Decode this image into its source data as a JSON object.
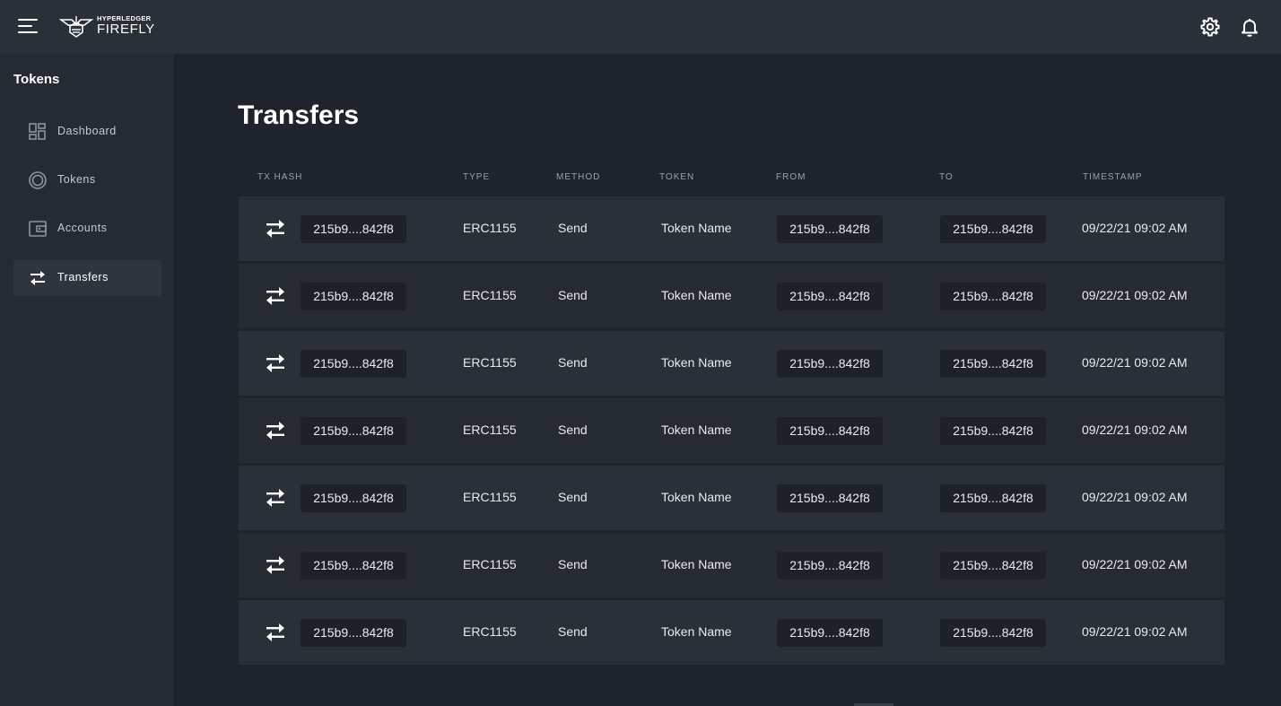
{
  "header": {
    "logo_small": "HYPERLEDGER",
    "logo_big": "FIREFLY",
    "menu_icon": "hamburger-menu-icon",
    "settings_icon": "gear-icon",
    "notifications_icon": "bell-icon"
  },
  "sidebar": {
    "title": "Tokens",
    "items": [
      {
        "label": "Dashboard",
        "icon": "dashboard-icon",
        "active": false
      },
      {
        "label": "Tokens",
        "icon": "token-icon",
        "active": false
      },
      {
        "label": "Accounts",
        "icon": "wallet-icon",
        "active": false
      },
      {
        "label": "Transfers",
        "icon": "transfer-arrows-icon",
        "active": true
      }
    ]
  },
  "main": {
    "title": "Transfers",
    "columns": [
      "TX HASH",
      "TYPE",
      "METHOD",
      "TOKEN",
      "FROM",
      "TO",
      "TIMESTAMP"
    ],
    "rows": [
      {
        "tx_hash": "215b9....842f8",
        "type": "ERC1155",
        "method": "Send",
        "token": "Token Name",
        "from": "215b9....842f8",
        "to": "215b9....842f8",
        "timestamp": "09/22/21 09:02 AM"
      },
      {
        "tx_hash": "215b9....842f8",
        "type": "ERC1155",
        "method": "Send",
        "token": "Token Name",
        "from": "215b9....842f8",
        "to": "215b9....842f8",
        "timestamp": "09/22/21 09:02 AM"
      },
      {
        "tx_hash": "215b9....842f8",
        "type": "ERC1155",
        "method": "Send",
        "token": "Token Name",
        "from": "215b9....842f8",
        "to": "215b9....842f8",
        "timestamp": "09/22/21 09:02 AM"
      },
      {
        "tx_hash": "215b9....842f8",
        "type": "ERC1155",
        "method": "Send",
        "token": "Token Name",
        "from": "215b9....842f8",
        "to": "215b9....842f8",
        "timestamp": "09/22/21 09:02 AM"
      },
      {
        "tx_hash": "215b9....842f8",
        "type": "ERC1155",
        "method": "Send",
        "token": "Token Name",
        "from": "215b9....842f8",
        "to": "215b9....842f8",
        "timestamp": "09/22/21 09:02 AM"
      },
      {
        "tx_hash": "215b9....842f8",
        "type": "ERC1155",
        "method": "Send",
        "token": "Token Name",
        "from": "215b9....842f8",
        "to": "215b9....842f8",
        "timestamp": "09/22/21 09:02 AM"
      },
      {
        "tx_hash": "215b9....842f8",
        "type": "ERC1155",
        "method": "Send",
        "token": "Token Name",
        "from": "215b9....842f8",
        "to": "215b9....842f8",
        "timestamp": "09/22/21 09:02 AM"
      }
    ]
  },
  "colors": {
    "background": "#1f242c",
    "topbar": "#2a3038",
    "sidebar": "#252b33",
    "row": "#2a3038",
    "row_alt": "#262b32",
    "chip": "#1e2228",
    "text": "#ffffff",
    "muted": "#9aa0a9"
  }
}
